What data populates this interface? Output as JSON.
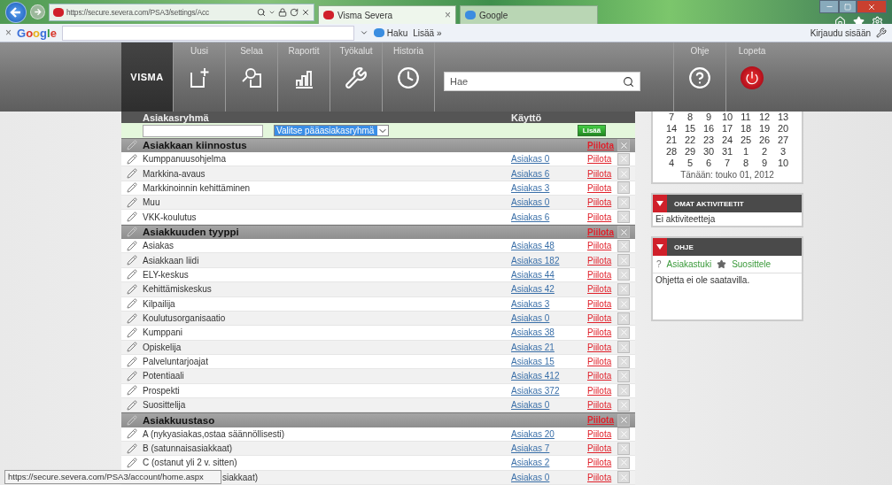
{
  "browser": {
    "address": "https://secure.severa.com/PSA3/settings/Acc",
    "tabs": [
      {
        "title": "Visma Severa",
        "selected": true,
        "close": "×"
      },
      {
        "title": "Google",
        "selected": false
      }
    ],
    "toolbar": {
      "close": "×",
      "logo": "Google",
      "search_button": "Haku",
      "more": "Lisää »",
      "sign_in": "Kirjaudu sisään"
    }
  },
  "app_header": {
    "logo": "VISMA",
    "nav": [
      {
        "label": "Uusi",
        "kind": "new"
      },
      {
        "label": "Selaa",
        "kind": "browse"
      },
      {
        "label": "Raportit",
        "kind": "reports"
      },
      {
        "label": "Työkalut",
        "kind": "tools"
      },
      {
        "label": "Historia",
        "kind": "history"
      }
    ],
    "search": {
      "placeholder": "Hae"
    },
    "actions": [
      {
        "label": "Ohje",
        "kind": "help"
      },
      {
        "label": "Lopeta",
        "kind": "logout"
      }
    ]
  },
  "table": {
    "columns": [
      "Asiakasryhmä",
      "Käyttö"
    ],
    "new_row": {
      "select": "Valitse pääasiakasryhmä",
      "button": "Lisää"
    },
    "groups": [
      {
        "name": "Asiakkaan kiinnostus",
        "hide": "Piilota",
        "items": [
          {
            "name": "Kumppanuusohjelma",
            "usage": "Asiakas 0",
            "hide": "Piilota"
          },
          {
            "name": "Markkina-avaus",
            "usage": "Asiakas 6",
            "hide": "Piilota"
          },
          {
            "name": "Markkinoinnin kehittäminen",
            "usage": "Asiakas 3",
            "hide": "Piilota"
          },
          {
            "name": "Muu",
            "usage": "Asiakas 0",
            "hide": "Piilota"
          },
          {
            "name": "VKK-koulutus",
            "usage": "Asiakas 6",
            "hide": "Piilota"
          }
        ]
      },
      {
        "name": "Asiakkuuden tyyppi",
        "hide": "Piilota",
        "items": [
          {
            "name": "Asiakas",
            "usage": "Asiakas 48",
            "hide": "Piilota"
          },
          {
            "name": "Asiakkaan liidi",
            "usage": "Asiakas 182",
            "hide": "Piilota"
          },
          {
            "name": "ELY-keskus",
            "usage": "Asiakas 44",
            "hide": "Piilota"
          },
          {
            "name": "Kehittämiskeskus",
            "usage": "Asiakas 42",
            "hide": "Piilota"
          },
          {
            "name": "Kilpailija",
            "usage": "Asiakas 3",
            "hide": "Piilota"
          },
          {
            "name": "Koulutusorganisaatio",
            "usage": "Asiakas 0",
            "hide": "Piilota"
          },
          {
            "name": "Kumppani",
            "usage": "Asiakas 38",
            "hide": "Piilota"
          },
          {
            "name": "Opiskelija",
            "usage": "Asiakas 21",
            "hide": "Piilota"
          },
          {
            "name": "Palveluntarjoajat",
            "usage": "Asiakas 15",
            "hide": "Piilota"
          },
          {
            "name": "Potentiaali",
            "usage": "Asiakas 412",
            "hide": "Piilota"
          },
          {
            "name": "Prospekti",
            "usage": "Asiakas 372",
            "hide": "Piilota"
          },
          {
            "name": "Suosittelija",
            "usage": "Asiakas 0",
            "hide": "Piilota"
          }
        ]
      },
      {
        "name": "Asiakkuustaso",
        "hide": "Piilota",
        "items": [
          {
            "name": "A (nykyasiakas,ostaa säännöllisesti)",
            "usage": "Asiakas 20",
            "hide": "Piilota"
          },
          {
            "name": "B (satunnaisasiakkaat)",
            "usage": "Asiakas 7",
            "hide": "Piilota"
          },
          {
            "name": "C (ostanut yli 2 v. sitten)",
            "usage": "Asiakas 2",
            "hide": "Piilota"
          },
          {
            "name": "siakkaat)",
            "usage": "Asiakas 0",
            "hide": "Piilota",
            "covered": true
          }
        ]
      }
    ]
  },
  "sidebar": {
    "calendar": {
      "weeks": [
        [
          "7",
          "8",
          "9",
          "10",
          "11",
          "12",
          "13"
        ],
        [
          "14",
          "15",
          "16",
          "17",
          "18",
          "19",
          "20"
        ],
        [
          "21",
          "22",
          "23",
          "24",
          "25",
          "26",
          "27"
        ],
        [
          "28",
          "29",
          "30",
          "31",
          "1",
          "2",
          "3"
        ],
        [
          "4",
          "5",
          "6",
          "7",
          "8",
          "9",
          "10"
        ]
      ],
      "today": "Tänään: touko 01, 2012"
    },
    "panels": [
      {
        "title": "OMAT AKTIVITEETIT",
        "body": "Ei aktiviteetteja"
      },
      {
        "title": "OHJE",
        "links": [
          {
            "kind": "help",
            "glyph": "?",
            "label": "Asiakastuki"
          },
          {
            "kind": "recommend",
            "label": "Suosittele"
          }
        ],
        "body": "Ohjetta ei ole saatavilla."
      }
    ]
  },
  "status_tooltip": "https://secure.severa.com/PSA3/account/home.aspx"
}
